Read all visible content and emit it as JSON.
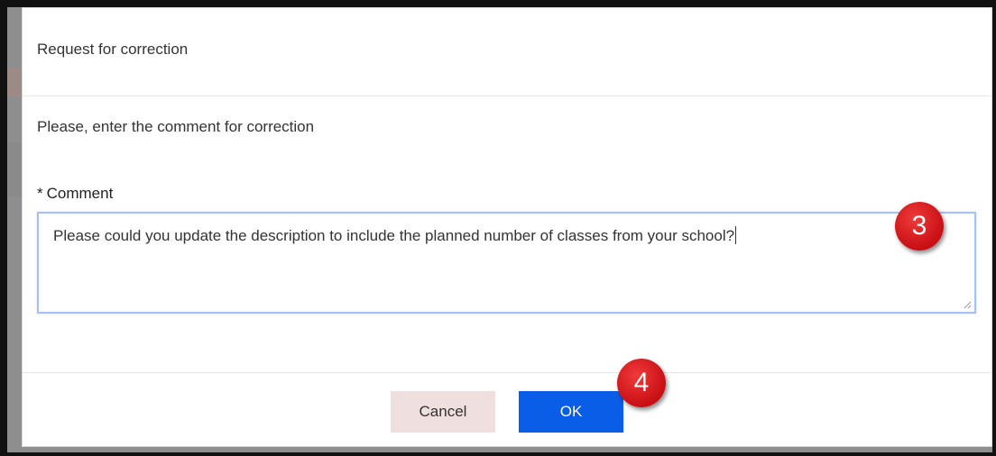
{
  "dialog": {
    "title": "Request for correction",
    "prompt": "Please, enter the comment for correction",
    "comment": {
      "required_marker": "*",
      "label": "Comment",
      "value": "Please could you update the description to include the planned number of classes from your school?"
    },
    "buttons": {
      "cancel": "Cancel",
      "ok": "OK"
    }
  },
  "markers": {
    "step_3": "3",
    "step_4": "4"
  },
  "colors": {
    "ok_button": "#0a5de6",
    "cancel_button": "#f0dfdf",
    "marker": "#d61a1f",
    "input_focus_border": "#a7c1f3"
  }
}
